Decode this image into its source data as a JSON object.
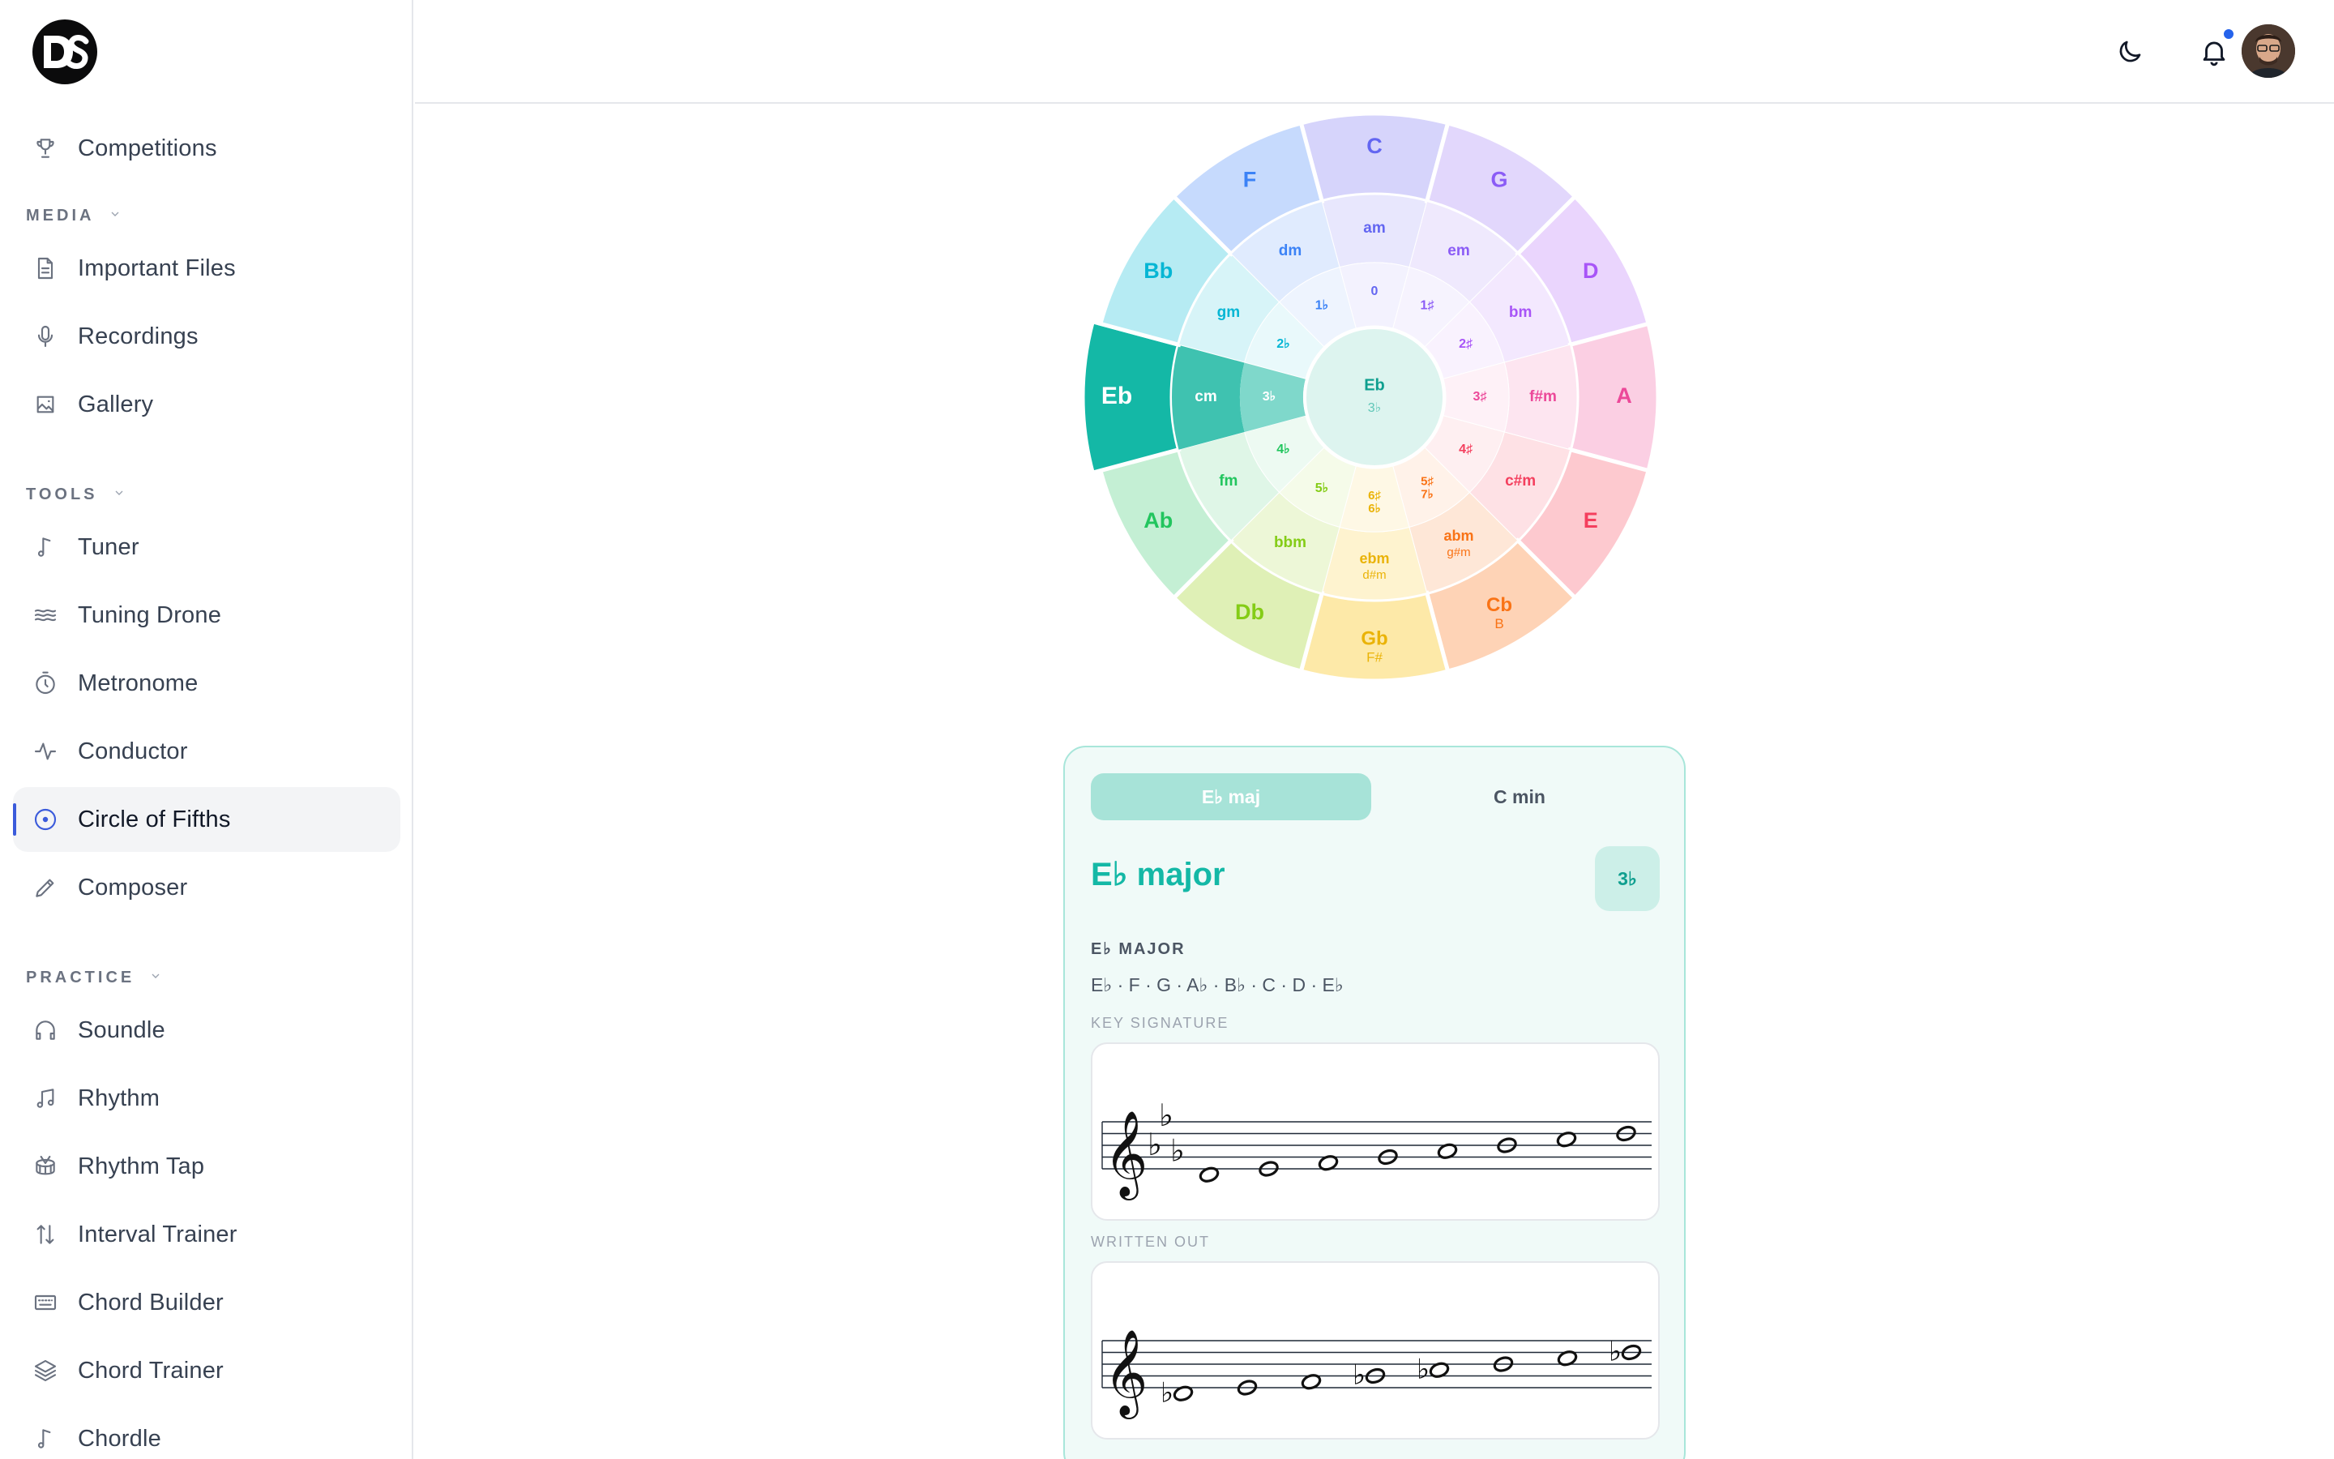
{
  "app": {
    "logo_text": "DS"
  },
  "sidebar": {
    "top_item": {
      "label": "Competitions",
      "icon": "trophy-icon"
    },
    "sections": [
      {
        "title": "MEDIA",
        "items": [
          {
            "label": "Important Files",
            "icon": "file-icon"
          },
          {
            "label": "Recordings",
            "icon": "microphone-icon"
          },
          {
            "label": "Gallery",
            "icon": "image-icon"
          }
        ]
      },
      {
        "title": "TOOLS",
        "items": [
          {
            "label": "Tuner",
            "icon": "music-note-icon"
          },
          {
            "label": "Tuning Drone",
            "icon": "waves-icon"
          },
          {
            "label": "Metronome",
            "icon": "timer-icon"
          },
          {
            "label": "Conductor",
            "icon": "pulse-icon"
          },
          {
            "label": "Circle of Fifths",
            "icon": "circle-dot-icon",
            "active": true
          },
          {
            "label": "Composer",
            "icon": "pencil-icon"
          }
        ]
      },
      {
        "title": "PRACTICE",
        "items": [
          {
            "label": "Soundle",
            "icon": "headphones-icon"
          },
          {
            "label": "Rhythm",
            "icon": "music-notes-icon"
          },
          {
            "label": "Rhythm Tap",
            "icon": "drum-icon"
          },
          {
            "label": "Interval Trainer",
            "icon": "arrows-up-down-icon"
          },
          {
            "label": "Chord Builder",
            "icon": "keyboard-icon"
          },
          {
            "label": "Chord Trainer",
            "icon": "layers-icon"
          },
          {
            "label": "Chordle",
            "icon": "music-note-icon"
          }
        ]
      }
    ]
  },
  "header": {
    "theme_icon": "moon-icon",
    "notifications_icon": "bell-icon",
    "has_notification": true
  },
  "circle": {
    "center": {
      "key": "Eb",
      "signature": "3♭"
    },
    "selected_index": 9,
    "majors": [
      {
        "label": "C",
        "sub": "",
        "color": "#6366f1",
        "bg": "#d6d4fb"
      },
      {
        "label": "G",
        "sub": "",
        "color": "#8b5cf6",
        "bg": "#e2d7fc"
      },
      {
        "label": "D",
        "sub": "",
        "color": "#a855f7",
        "bg": "#ead5fd"
      },
      {
        "label": "A",
        "sub": "",
        "color": "#ec4899",
        "bg": "#fbcfe3"
      },
      {
        "label": "E",
        "sub": "",
        "color": "#f43f5e",
        "bg": "#fdc9cf"
      },
      {
        "label": "Cb",
        "sub": "B",
        "color": "#f97316",
        "bg": "#fed3b6"
      },
      {
        "label": "Gb",
        "sub": "F#",
        "color": "#eab308",
        "bg": "#fde9a8"
      },
      {
        "label": "Db",
        "sub": "",
        "color": "#84cc16",
        "bg": "#dff0b6"
      },
      {
        "label": "Ab",
        "sub": "",
        "color": "#22c55e",
        "bg": "#c4efd4"
      },
      {
        "label": "Eb",
        "sub": "",
        "color": "#ffffff",
        "bg": "#14b8a6"
      },
      {
        "label": "Bb",
        "sub": "",
        "color": "#06b6d4",
        "bg": "#b6ebf3"
      },
      {
        "label": "F",
        "sub": "",
        "color": "#3b82f6",
        "bg": "#c6dafd"
      }
    ],
    "minors": [
      {
        "label": "am",
        "sub": ""
      },
      {
        "label": "em",
        "sub": ""
      },
      {
        "label": "bm",
        "sub": ""
      },
      {
        "label": "f#m",
        "sub": ""
      },
      {
        "label": "c#m",
        "sub": ""
      },
      {
        "label": "abm",
        "sub": "g#m"
      },
      {
        "label": "ebm",
        "sub": "d#m"
      },
      {
        "label": "bbm",
        "sub": ""
      },
      {
        "label": "fm",
        "sub": ""
      },
      {
        "label": "cm",
        "sub": ""
      },
      {
        "label": "gm",
        "sub": ""
      },
      {
        "label": "dm",
        "sub": ""
      }
    ],
    "signatures": [
      {
        "label": "0",
        "sub": ""
      },
      {
        "label": "1♯",
        "sub": ""
      },
      {
        "label": "2♯",
        "sub": ""
      },
      {
        "label": "3♯",
        "sub": ""
      },
      {
        "label": "4♯",
        "sub": ""
      },
      {
        "label": "5♯",
        "sub": "7♭"
      },
      {
        "label": "6♯",
        "sub": "6♭"
      },
      {
        "label": "5♭",
        "sub": ""
      },
      {
        "label": "4♭",
        "sub": ""
      },
      {
        "label": "3♭",
        "sub": ""
      },
      {
        "label": "2♭",
        "sub": ""
      },
      {
        "label": "1♭",
        "sub": ""
      }
    ]
  },
  "card": {
    "tabs": [
      {
        "label": "E♭ maj",
        "active": true
      },
      {
        "label": "C min",
        "active": false
      }
    ],
    "title": "E♭ major",
    "badge": "3♭",
    "scale_heading": "E♭ MAJOR",
    "scale_notes": "E♭ · F · G · A♭ · B♭ · C · D · E♭",
    "key_signature_label": "KEY SIGNATURE",
    "written_out_label": "WRITTEN OUT"
  }
}
